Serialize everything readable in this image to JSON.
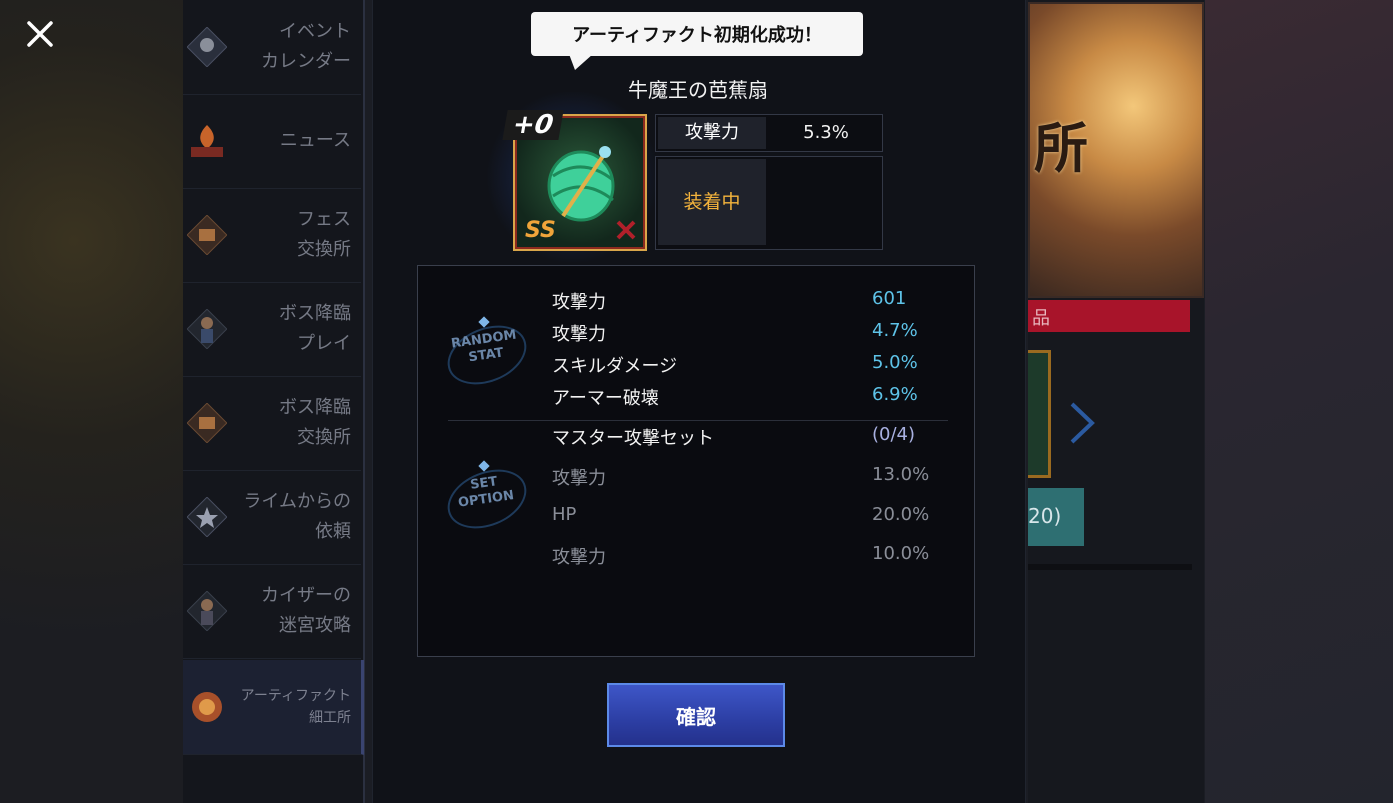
{
  "side_menu": {
    "items": [
      {
        "label": "イベント\nカレンダー",
        "icon": "calendar-icon"
      },
      {
        "label": "ニュース",
        "icon": "news-icon"
      },
      {
        "label": "フェス\n交換所",
        "icon": "exchange-icon"
      },
      {
        "label": "ボス降臨\nプレイ",
        "icon": "boss-icon"
      },
      {
        "label": "ボス降臨\n交換所",
        "icon": "exchange-icon"
      },
      {
        "label": "ライムからの\n依頼",
        "icon": "star-icon"
      },
      {
        "label": "カイザーの\n迷宮攻略",
        "icon": "character-icon"
      },
      {
        "label": "アーティファクト\n細工所",
        "icon": "artifact-icon"
      }
    ]
  },
  "right_panel": {
    "banner_text": "所",
    "strip_text": "品",
    "partial_text": "20)"
  },
  "dialog": {
    "toast": "アーティファクト初期化成功！",
    "item_name": "牛魔王の芭蕉扇",
    "item_level": "+0",
    "item_grade": "SS",
    "main_stat": {
      "label": "攻撃力",
      "value": "5.3%"
    },
    "equip_status": "装着中",
    "random_stat_emblem": [
      "RANDOM",
      "STAT"
    ],
    "random_stats": [
      {
        "label": "攻撃力",
        "value": "601"
      },
      {
        "label": "攻撃力",
        "value": "4.7%"
      },
      {
        "label": "スキルダメージ",
        "value": "5.0%"
      },
      {
        "label": "アーマー破壊",
        "value": "6.9%"
      }
    ],
    "set_option_emblem": [
      "SET",
      "OPTION"
    ],
    "set_option": {
      "title": "マスター攻撃セット",
      "progress": "(0/4)",
      "stats": [
        {
          "label": "攻撃力",
          "value": "13.0%"
        },
        {
          "label": "HP",
          "value": "20.0%"
        },
        {
          "label": "攻撃力",
          "value": "10.0%"
        }
      ]
    },
    "confirm_label": "確認"
  },
  "colors": {
    "accent_blue": "#5ec3e8",
    "equip_orange": "#f4b43c",
    "button_blue": "#2c3ea4"
  }
}
